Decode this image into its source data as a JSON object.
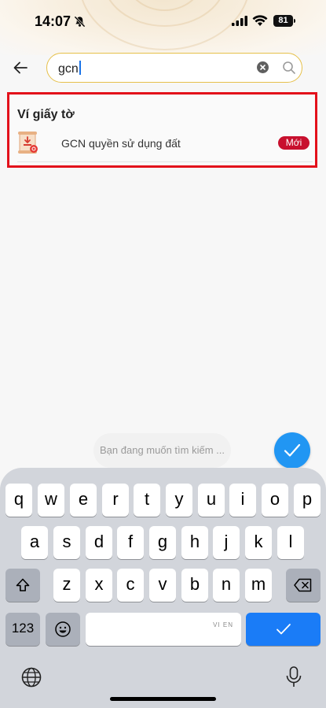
{
  "status_bar": {
    "time": "14:07",
    "battery": "81",
    "icons": [
      "bell-slash-icon",
      "signal-icon",
      "wifi-icon",
      "battery-icon"
    ]
  },
  "search": {
    "value": "gcn",
    "back_icon": "arrow-left-icon",
    "clear_icon": "clear-x-icon",
    "search_icon": "magnifier-icon",
    "border_color": "#e6c04a"
  },
  "results": {
    "section_title": "Ví giấy tờ",
    "highlight_color": "#e3111b",
    "items": [
      {
        "label": "GCN quyền sử dụng đất",
        "badge": "Mới",
        "icon": "land-certificate-icon"
      }
    ]
  },
  "suggestion": {
    "text": "Bạn đang muốn tìm kiếm ..."
  },
  "confirm_button": {
    "icon": "checkmark-icon",
    "color": "#2196f3"
  },
  "keyboard": {
    "row1": [
      "q",
      "w",
      "e",
      "r",
      "t",
      "y",
      "u",
      "i",
      "o",
      "p"
    ],
    "row2": [
      "a",
      "s",
      "d",
      "f",
      "g",
      "h",
      "j",
      "k",
      "l"
    ],
    "row3": [
      "z",
      "x",
      "c",
      "v",
      "b",
      "n",
      "m"
    ],
    "numbers_label": "123",
    "space_hint": "VI EN",
    "icons": [
      "shift-icon",
      "backspace-icon",
      "emoji-icon",
      "globe-icon",
      "microphone-icon",
      "return-check-icon"
    ]
  }
}
